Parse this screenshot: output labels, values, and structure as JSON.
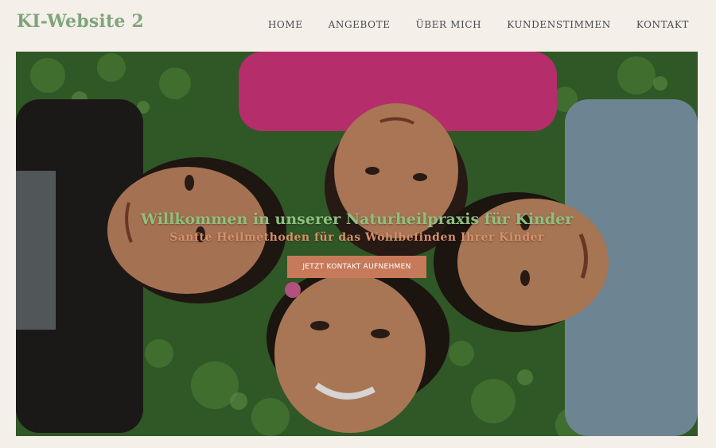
{
  "header": {
    "logo": "KI-Website 2",
    "nav": [
      "HOME",
      "ANGEBOTE",
      "ÜBER MICH",
      "KUNDENSTIMMEN",
      "KONTAKT"
    ]
  },
  "hero": {
    "title": "Willkommen in unserer Naturheilpraxis für Kinder",
    "subtitle": "Sanfte Heilmethoden für das Wohlbefinden Ihrer Kinder",
    "cta_label": "JETZT KONTAKT AUFNEHMEN",
    "image_icon": "children-photo"
  },
  "colors": {
    "background": "#f4efe9",
    "logo": "#7ea57c",
    "title": "#8fbf7f",
    "subtitle": "#d7906a",
    "cta": "#c77a5a"
  }
}
